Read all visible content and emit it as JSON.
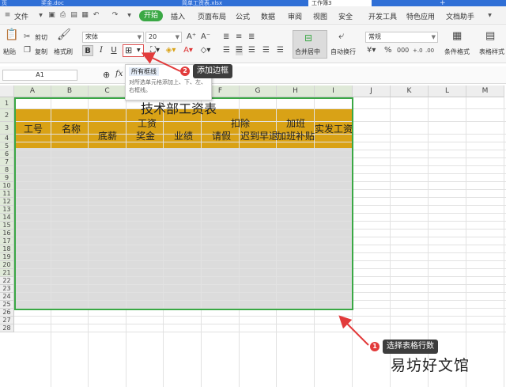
{
  "tabs": [
    "页",
    "奖金.doc",
    "简单工资表.xlsx",
    "工作簿3"
  ],
  "menu": {
    "file": "文件",
    "start": "开始",
    "items": [
      "插入",
      "页面布局",
      "公式",
      "数据",
      "审阅",
      "视图",
      "安全",
      "开发工具",
      "特色应用",
      "文档助手"
    ]
  },
  "ribbon": {
    "paste": "粘贴",
    "cut": "剪切",
    "copy": "复制",
    "format_painter": "格式刷",
    "font_name": "宋体",
    "font_size": "20",
    "merge_center": "合并居中",
    "wrap_text": "自动换行",
    "number_format": "常规",
    "cond_format": "条件格式",
    "table_style": "表格样式"
  },
  "formula_bar": {
    "cell_ref": "A1",
    "fx": "fx"
  },
  "grid": {
    "columns": [
      "A",
      "B",
      "C",
      "D",
      "E",
      "F",
      "G",
      "H",
      "I",
      "J",
      "K",
      "L",
      "M"
    ],
    "rows": [
      "1",
      "2",
      "3",
      "4",
      "5",
      "6",
      "7",
      "8",
      "9",
      "10",
      "11",
      "12",
      "13",
      "14",
      "15",
      "16",
      "17",
      "18",
      "19",
      "20",
      "21",
      "22",
      "23",
      "24",
      "25",
      "26",
      "27",
      "28"
    ]
  },
  "sheet": {
    "title": "技术部工资表",
    "h_id": "工号",
    "h_name": "名称",
    "h_wage": "工资",
    "h_base": "底薪",
    "h_bonus": "奖金",
    "h_perf": "业绩",
    "h_deduct": "扣除",
    "h_leave": "请假",
    "h_late": "迟到早退",
    "h_overtime": "加班",
    "h_ot_pay": "加班补贴",
    "h_net": "实发工资"
  },
  "popup": {
    "title": "所有框线",
    "desc": "对所选单元格添加上、下、左、右框线。"
  },
  "callouts": {
    "one_num": "1",
    "one_text": "选择表格行数",
    "two_num": "2",
    "two_text": "添加边框"
  },
  "watermark": "易坊好文馆",
  "colors": {
    "accent": "#3aa845",
    "header_fill": "#d9a216",
    "callout_badge": "#e23b3b"
  }
}
